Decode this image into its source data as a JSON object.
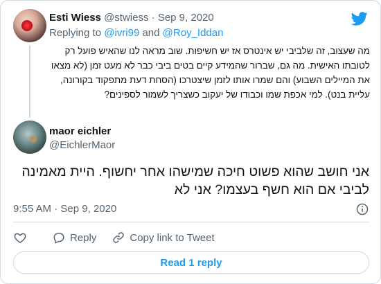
{
  "brand": {
    "accent_color": "#1d9bf0",
    "logo_icon": "twitter-bird-icon"
  },
  "parent_tweet": {
    "author_name": "Esti Wiess",
    "handle": "@stwiess",
    "separator": "·",
    "date": "Sep 9, 2020",
    "replying_to_label": "Replying to",
    "replying_to_users": [
      "@ivri99",
      "@Roy_Iddan"
    ],
    "replying_to_joiner": "and",
    "text": "מה שעצוב, זה שלביבי יש אינטרס אז יש חשיפות. שוב מראה לנו שהאיש פועל רק לטובתו האישית. מה גם, שברור שהמידע קיים בטים ביבי כבר לא מעט זמן (לא מצאו את המיילים השבוע) והם שמרו אותו לזמן שיצטרכו (הסחת דעת מתפקוד בקורונה, עליית בנט). למי אכפת שמו וכבודו של יעקוב כשצריך לשמור לספינים?"
  },
  "main_tweet": {
    "author_name": "maor eichler",
    "handle": "@EichlerMaor",
    "text": "אני חושב שהוא פשוט חיכה שמישהו אחר יחשוף. היית מאמינה לביבי אם הוא חשף בעצמו? אני לא",
    "time": "9:55 AM",
    "separator": "·",
    "date": "Sep 9, 2020"
  },
  "actions": {
    "like_icon": "heart-icon",
    "reply_label": "Reply",
    "copy_link_label": "Copy link to Tweet"
  },
  "read_replies_label": "Read 1 reply"
}
